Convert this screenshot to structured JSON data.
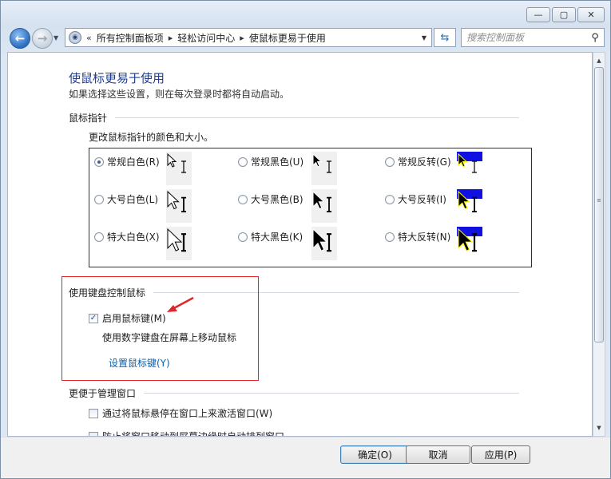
{
  "window": {
    "caption": {
      "minimize_glyph": "—",
      "maximize_glyph": "▢",
      "close_glyph": "✕"
    }
  },
  "nav": {
    "back_glyph": "←",
    "forward_glyph": "→",
    "address": {
      "overflow_glyph": "«",
      "crumbs": [
        "所有控制面板项",
        "轻松访问中心",
        "使鼠标更易于使用"
      ],
      "sep_glyph": "▸"
    },
    "refresh_glyph": "⇆",
    "search": {
      "placeholder": "搜索控制面板"
    }
  },
  "page": {
    "title": "使鼠标更易于使用",
    "subtitle": "如果选择这些设置，则在每次登录时都将自动启动。"
  },
  "pointers": {
    "heading": "鼠标指针",
    "description": "更改鼠标指针的颜色和大小。",
    "options": [
      {
        "label": "常规白色(R)",
        "checked": true,
        "style": "white",
        "size": "normal"
      },
      {
        "label": "常规黑色(U)",
        "checked": false,
        "style": "black",
        "size": "normal"
      },
      {
        "label": "常规反转(G)",
        "checked": false,
        "style": "inverted",
        "size": "normal"
      },
      {
        "label": "大号白色(L)",
        "checked": false,
        "style": "white",
        "size": "large"
      },
      {
        "label": "大号黑色(B)",
        "checked": false,
        "style": "black",
        "size": "large"
      },
      {
        "label": "大号反转(I)",
        "checked": false,
        "style": "inverted",
        "size": "large"
      },
      {
        "label": "特大白色(X)",
        "checked": false,
        "style": "white",
        "size": "xlarge"
      },
      {
        "label": "特大黑色(K)",
        "checked": false,
        "style": "black",
        "size": "xlarge"
      },
      {
        "label": "特大反转(N)",
        "checked": false,
        "style": "inverted",
        "size": "xlarge"
      }
    ]
  },
  "keyboard": {
    "heading": "使用键盘控制鼠标",
    "enable_label": "启用鼠标键(M)",
    "enable_checked": true,
    "description": "使用数字键盘在屏幕上移动鼠标",
    "setup_link": "设置鼠标键(Y)"
  },
  "windows_mgmt": {
    "heading": "更便于管理窗口",
    "hover_activate_label": "通过将鼠标悬停在窗口上来激活窗口(W)",
    "hover_activate_checked": false,
    "prevent_arrange_label": "防止将窗口移动到屏幕边缘时自动排列窗口",
    "prevent_arrange_checked": false
  },
  "buttons": {
    "ok": "确定(O)",
    "cancel": "取消",
    "apply": "应用(P)"
  },
  "colors": {
    "title_blue": "#1e3e94",
    "link_blue": "#0d5fa8",
    "annotation_red": "#e0262b",
    "inverted_band": "#1010e0"
  }
}
